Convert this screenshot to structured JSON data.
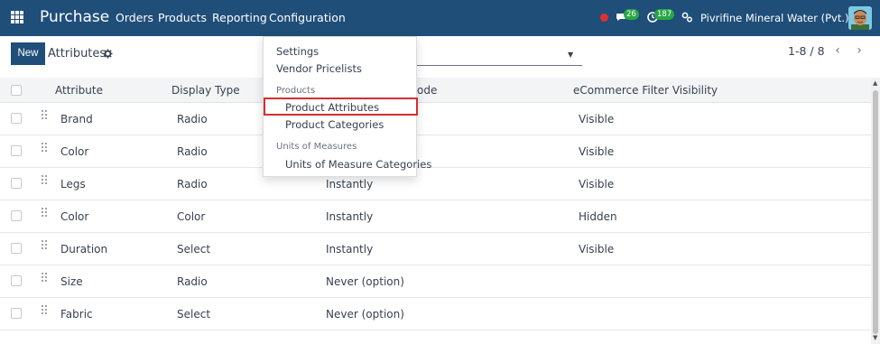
{
  "navbar": {
    "app_name": "Purchase",
    "menu": [
      "Orders",
      "Products",
      "Reporting",
      "Configuration"
    ],
    "chat_badge": "26",
    "activity_badge": "187",
    "company": "Pivrifine Mineral Water (Pvt.) Ltd.",
    "colors": {
      "bar": "#1f4e79",
      "status_dot": "#e03131",
      "badge": "#28a745"
    }
  },
  "control_panel": {
    "new_label": "New",
    "title": "Attributes",
    "pager": "1-8 / 8"
  },
  "table": {
    "columns": [
      "Attribute",
      "Display Type",
      "Variants Creation Mode",
      "eCommerce Filter Visibility"
    ],
    "visible_header_fragment": "ode",
    "rows": [
      {
        "attribute": "Brand",
        "display_type": "Radio",
        "mode": "",
        "visibility": "Visible"
      },
      {
        "attribute": "Color",
        "display_type": "Radio",
        "mode": "",
        "visibility": "Visible"
      },
      {
        "attribute": "Legs",
        "display_type": "Radio",
        "mode": "Instantly",
        "visibility": "Visible"
      },
      {
        "attribute": "Color",
        "display_type": "Color",
        "mode": "Instantly",
        "visibility": "Hidden"
      },
      {
        "attribute": "Duration",
        "display_type": "Select",
        "mode": "Instantly",
        "visibility": "Visible"
      },
      {
        "attribute": "Size",
        "display_type": "Radio",
        "mode": "Never (option)",
        "visibility": ""
      },
      {
        "attribute": "Fabric",
        "display_type": "Select",
        "mode": "Never (option)",
        "visibility": ""
      }
    ]
  },
  "dropdown": {
    "settings": "Settings",
    "vendor_pricelists": "Vendor Pricelists",
    "products_header": "Products",
    "product_attributes": "Product Attributes",
    "product_categories": "Product Categories",
    "uom_header": "Units of Measures",
    "uom_categories": "Units of Measure Categories",
    "highlight_color": "#d32f2f"
  }
}
